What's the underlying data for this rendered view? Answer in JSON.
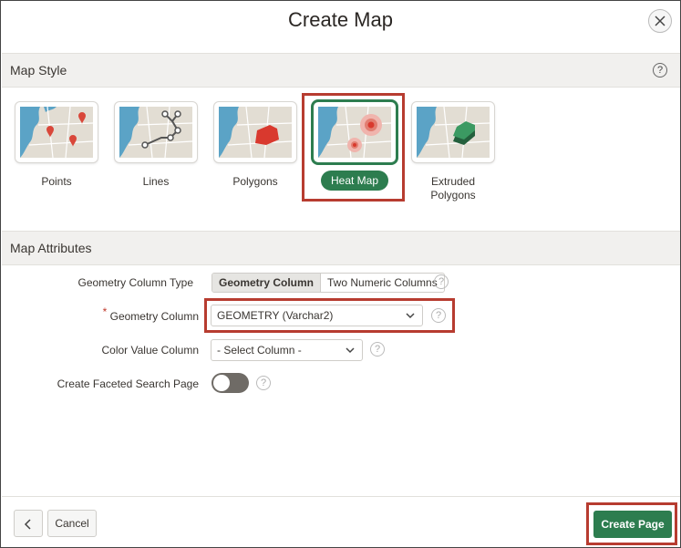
{
  "dialog": {
    "title": "Create Map",
    "close_icon": "close-icon"
  },
  "map_style": {
    "header": "Map Style",
    "help_glyph": "?",
    "options": [
      {
        "label": "Points",
        "icon": "points-map-icon"
      },
      {
        "label": "Lines",
        "icon": "lines-map-icon"
      },
      {
        "label": "Polygons",
        "icon": "polygons-map-icon"
      },
      {
        "label": "Heat Map",
        "icon": "heat-map-icon",
        "selected": true
      },
      {
        "label": "Extruded\nPolygons",
        "icon": "extruded-polygons-map-icon"
      }
    ]
  },
  "map_attributes": {
    "header": "Map Attributes",
    "geometry_column_type": {
      "label": "Geometry Column Type",
      "options": [
        "Geometry Column",
        "Two Numeric Columns"
      ],
      "selected": "Geometry Column"
    },
    "geometry_column": {
      "label": "Geometry Column",
      "required_marker": "*",
      "value": "GEOMETRY (Varchar2)"
    },
    "color_value_column": {
      "label": "Color Value Column",
      "value": "- Select Column -"
    },
    "faceted_search": {
      "label": "Create Faceted Search Page",
      "enabled": false
    },
    "help_glyph": "?"
  },
  "footer": {
    "back_glyph": "<",
    "cancel_label": "Cancel",
    "create_label": "Create Page"
  },
  "colors": {
    "accent": "#2d7d4f",
    "highlight_frame": "#b73c30",
    "map_water": "#5ba3c6",
    "map_land": "#e2ddd3"
  }
}
